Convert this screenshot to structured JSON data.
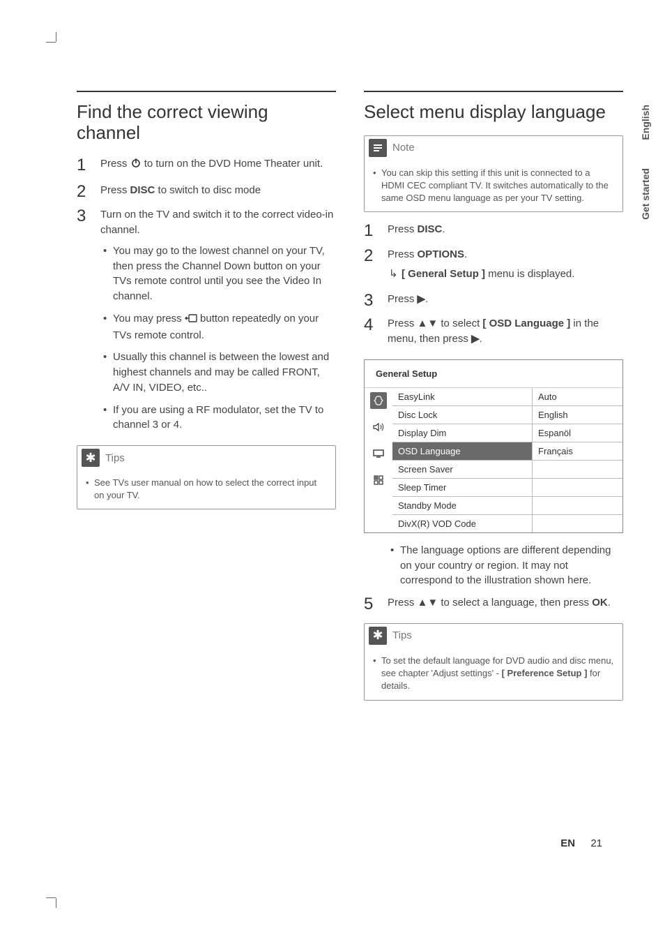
{
  "sideTabs": {
    "english": "English",
    "getStarted": "Get started"
  },
  "left": {
    "title": "Find the correct viewing channel",
    "steps": {
      "s1_a": "Press ",
      "s1_b": " to turn on the DVD Home Theater unit.",
      "s2_a": "Press ",
      "s2_disc": "DISC",
      "s2_b": " to switch to disc mode",
      "s3": "Turn on the TV and switch it to the correct video-in channel.",
      "s3_b1": "You may go to the lowest channel on your TV, then press the Channel Down button on your TVs remote control until you see the Video In channel.",
      "s3_b2_a": "You may press ",
      "s3_b2_b": " button repeatedly on your TVs remote control.",
      "s3_b3": "Usually this channel is between the lowest and highest channels and may be called FRONT, A/V IN, VIDEO, etc..",
      "s3_b4": "If you are using a RF modulator, set the TV to channel 3 or 4."
    },
    "tips": {
      "label": "Tips",
      "body": "See TVs user manual on how to select the correct input on your TV."
    }
  },
  "right": {
    "title": "Select menu display language",
    "note": {
      "label": "Note",
      "body": "You can skip this setting if this unit is connected to a HDMI CEC compliant TV. It switches automatically to the same OSD menu language as per your TV setting."
    },
    "steps": {
      "s1_a": "Press ",
      "s1_disc": "DISC",
      "s1_b": ".",
      "s2_a": "Press ",
      "s2_opt": "OPTIONS",
      "s2_b": ".",
      "s2_res_a": "[ General Setup ]",
      "s2_res_b": " menu is displayed.",
      "s3_a": "Press ",
      "s3_sym": "▶",
      "s3_b": ".",
      "s4_a": "Press ",
      "s4_sym": "▲▼",
      "s4_b": " to select ",
      "s4_bold": "[ OSD Language ]",
      "s4_c": " in the menu, then press ",
      "s4_sym2": "▶",
      "s4_d": "."
    },
    "osd": {
      "title": "General Setup",
      "rows": [
        {
          "left": "EasyLink",
          "right": "Auto",
          "selected": false
        },
        {
          "left": "Disc Lock",
          "right": "English",
          "selected": false
        },
        {
          "left": "Display Dim",
          "right": "Espanöl",
          "selected": false
        },
        {
          "left": "OSD Language",
          "right": "Français",
          "selected": true
        },
        {
          "left": "Screen Saver",
          "right": "",
          "selected": false
        },
        {
          "left": "Sleep Timer",
          "right": "",
          "selected": false
        },
        {
          "left": "Standby Mode",
          "right": "",
          "selected": false
        },
        {
          "left": "DivX(R) VOD Code",
          "right": "",
          "selected": false
        }
      ]
    },
    "afterOsd": {
      "bullet": "The language options are different depending on your country or region. It may not correspond to the illustration shown here.",
      "s5_a": "Press ",
      "s5_sym": "▲▼",
      "s5_b": " to select a language, then press ",
      "s5_ok": "OK",
      "s5_c": "."
    },
    "tips": {
      "label": "Tips",
      "body_a": "To set the default language for DVD audio and disc menu, see chapter 'Adjust settings' - ",
      "body_bold": "[ Preference Setup ]",
      "body_b": " for details."
    }
  },
  "footer": {
    "lang": "EN",
    "page": "21"
  }
}
